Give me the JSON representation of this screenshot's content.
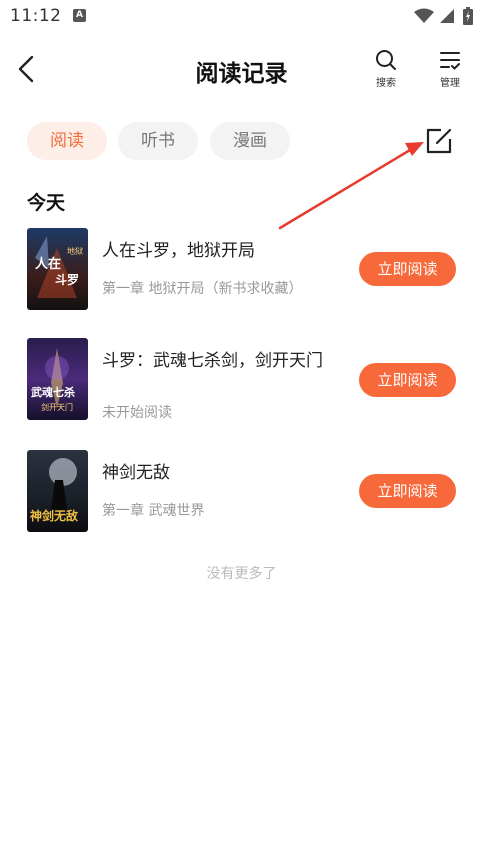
{
  "status": {
    "time": "11:12",
    "notif_letter": "A"
  },
  "header": {
    "title": "阅读记录",
    "search_label": "搜索",
    "manage_label": "管理"
  },
  "tabs": [
    {
      "label": "阅读",
      "active": true
    },
    {
      "label": "听书",
      "active": false
    },
    {
      "label": "漫画",
      "active": false
    }
  ],
  "section": {
    "title": "今天"
  },
  "books": [
    {
      "title": "人在斗罗，地狱开局",
      "subtitle": "第一章 地狱开局（新书求收藏）",
      "button": "立即阅读",
      "cover_text": "人在斗罗地狱开局"
    },
    {
      "title": "斗罗：武魂七杀剑，剑开天门",
      "subtitle": "未开始阅读",
      "button": "立即阅读",
      "cover_text": "武魂七杀剑 剑开天门"
    },
    {
      "title": "神剑无敌",
      "subtitle": "第一章 武魂世界",
      "button": "立即阅读",
      "cover_text": "神剑无敌"
    }
  ],
  "footer": {
    "no_more": "没有更多了"
  },
  "colors": {
    "accent": "#f7683a",
    "tab_active_bg": "#fdeee7",
    "tab_active_text": "#f36d3a",
    "annotation_arrow": "#e83a2e"
  }
}
